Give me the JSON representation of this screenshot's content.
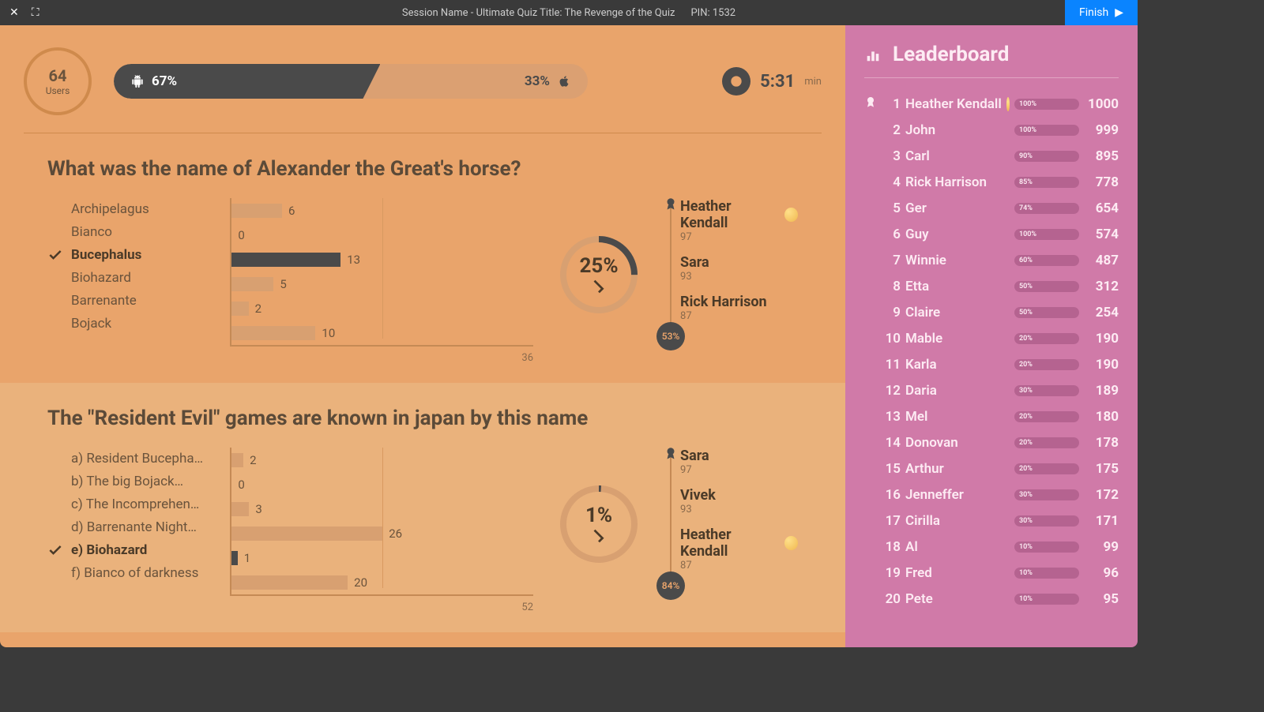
{
  "titlebar": {
    "session_label": "Session Name  -",
    "quiz_title": "  Ultimate Quiz Title: The Revenge of the Quiz",
    "pin_label": "PIN: 1532",
    "finish_label": "Finish"
  },
  "header": {
    "users_count": "64",
    "users_label": "Users",
    "android_pct": "67%",
    "ios_pct": "33%",
    "timer": "5:31",
    "timer_unit": "min"
  },
  "leaderboard": {
    "title": "Leaderboard",
    "rows": [
      {
        "rank": "1",
        "name": "Heather Kendall",
        "emoji": true,
        "pct": "100%",
        "pctv": 100,
        "score": "1000",
        "medal": true
      },
      {
        "rank": "2",
        "name": "John",
        "emoji": false,
        "pct": "100%",
        "pctv": 100,
        "score": "999",
        "medal": false
      },
      {
        "rank": "3",
        "name": "Carl",
        "emoji": false,
        "pct": "90%",
        "pctv": 90,
        "score": "895",
        "medal": false
      },
      {
        "rank": "4",
        "name": "Rick Harrison",
        "emoji": false,
        "pct": "85%",
        "pctv": 85,
        "score": "778",
        "medal": false
      },
      {
        "rank": "5",
        "name": "Ger",
        "emoji": false,
        "pct": "74%",
        "pctv": 74,
        "score": "654",
        "medal": false
      },
      {
        "rank": "6",
        "name": "Guy",
        "emoji": false,
        "pct": "100%",
        "pctv": 100,
        "score": "574",
        "medal": false
      },
      {
        "rank": "7",
        "name": "Winnie",
        "emoji": false,
        "pct": "60%",
        "pctv": 60,
        "score": "487",
        "medal": false
      },
      {
        "rank": "8",
        "name": "Etta",
        "emoji": false,
        "pct": "50%",
        "pctv": 50,
        "score": "312",
        "medal": false
      },
      {
        "rank": "9",
        "name": "Claire",
        "emoji": false,
        "pct": "50%",
        "pctv": 50,
        "score": "254",
        "medal": false
      },
      {
        "rank": "10",
        "name": "Mable",
        "emoji": false,
        "pct": "20%",
        "pctv": 20,
        "score": "190",
        "medal": false
      },
      {
        "rank": "11",
        "name": "Karla",
        "emoji": false,
        "pct": "20%",
        "pctv": 20,
        "score": "190",
        "medal": false
      },
      {
        "rank": "12",
        "name": "Daria",
        "emoji": false,
        "pct": "30%",
        "pctv": 30,
        "score": "189",
        "medal": false
      },
      {
        "rank": "13",
        "name": "Mel",
        "emoji": false,
        "pct": "20%",
        "pctv": 20,
        "score": "180",
        "medal": false
      },
      {
        "rank": "14",
        "name": "Donovan",
        "emoji": false,
        "pct": "20%",
        "pctv": 20,
        "score": "178",
        "medal": false
      },
      {
        "rank": "15",
        "name": "Arthur",
        "emoji": false,
        "pct": "20%",
        "pctv": 20,
        "score": "175",
        "medal": false
      },
      {
        "rank": "16",
        "name": "Jenneffer",
        "emoji": false,
        "pct": "30%",
        "pctv": 30,
        "score": "172",
        "medal": false
      },
      {
        "rank": "17",
        "name": "Cirilla",
        "emoji": false,
        "pct": "30%",
        "pctv": 30,
        "score": "171",
        "medal": false
      },
      {
        "rank": "18",
        "name": "Al",
        "emoji": false,
        "pct": "10%",
        "pctv": 10,
        "score": "99",
        "medal": false
      },
      {
        "rank": "19",
        "name": "Fred",
        "emoji": false,
        "pct": "10%",
        "pctv": 10,
        "score": "96",
        "medal": false
      },
      {
        "rank": "20",
        "name": "Pete",
        "emoji": false,
        "pct": "10%",
        "pctv": 10,
        "score": "95",
        "medal": false
      }
    ]
  },
  "questions": [
    {
      "title": "What was the name of Alexander the Great's horse?",
      "answers": [
        {
          "label": "Archipelagus",
          "correct": false
        },
        {
          "label": "Bianco",
          "correct": false
        },
        {
          "label": "Bucephalus",
          "correct": true
        },
        {
          "label": "Biohazard",
          "correct": false
        },
        {
          "label": "Barrenante",
          "correct": false
        },
        {
          "label": "Bojack",
          "correct": false
        }
      ],
      "correct_pct": "25%",
      "correct_pctv": 25,
      "top_badge": "53%",
      "top3": [
        {
          "name": "Heather Kendall",
          "score": "97",
          "emoji": true
        },
        {
          "name": "Sara",
          "score": "93",
          "emoji": false
        },
        {
          "name": "Rick Harrison",
          "score": "87",
          "emoji": false
        }
      ]
    },
    {
      "title": "The \"Resident Evil\" games are known in japan by this name",
      "answers": [
        {
          "label": "a) Resident Bucepha…",
          "correct": false
        },
        {
          "label": "b) The big Bojack…",
          "correct": false
        },
        {
          "label": "c) The Incomprehen…",
          "correct": false
        },
        {
          "label": "d) Barrenante Night…",
          "correct": false
        },
        {
          "label": "e) Biohazard",
          "correct": true
        },
        {
          "label": "f) Bianco of darkness",
          "correct": false
        }
      ],
      "correct_pct": "1%",
      "correct_pctv": 1,
      "top_badge": "84%",
      "top3": [
        {
          "name": "Sara",
          "score": "97",
          "emoji": false
        },
        {
          "name": "Vivek",
          "score": "93",
          "emoji": false
        },
        {
          "name": "Heather Kendall",
          "score": "87",
          "emoji": true
        }
      ]
    }
  ],
  "chart_data": [
    {
      "type": "bar",
      "title": "What was the name of Alexander the Great's horse?",
      "categories": [
        "Archipelagus",
        "Bianco",
        "Bucephalus",
        "Biohazard",
        "Barrenante",
        "Bojack"
      ],
      "values": [
        6,
        0,
        13,
        5,
        2,
        10
      ],
      "max": 36,
      "xlabel": "",
      "ylabel": ""
    },
    {
      "type": "bar",
      "title": "The \"Resident Evil\" games are known in japan by this name",
      "categories": [
        "a) Resident Bucepha…",
        "b) The big Bojack…",
        "c) The Incomprehen…",
        "d) Barrenante Night…",
        "e) Biohazard",
        "f) Bianco of darkness"
      ],
      "values": [
        2,
        0,
        3,
        26,
        1,
        20
      ],
      "max": 52,
      "xlabel": "",
      "ylabel": ""
    }
  ]
}
